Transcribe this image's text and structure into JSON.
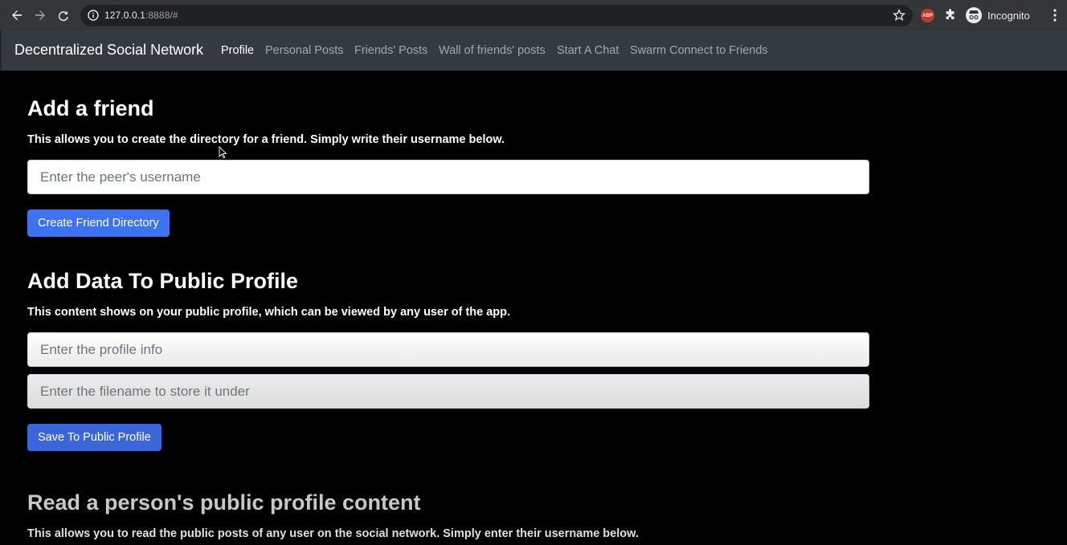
{
  "browser": {
    "url_host": "127.0.0.1",
    "url_rest": ":8888/#",
    "incognito_label": "Incognito",
    "abp_label": "ABP"
  },
  "navbar": {
    "brand": "Decentralized Social Network",
    "links": [
      {
        "label": "Profile",
        "active": true
      },
      {
        "label": "Personal Posts"
      },
      {
        "label": "Friends' Posts"
      },
      {
        "label": "Wall of friends' posts"
      },
      {
        "label": "Start A Chat"
      },
      {
        "label": "Swarm Connect to Friends"
      }
    ]
  },
  "add_friend": {
    "title": "Add a friend",
    "description": "This allows you to create the directory for a friend. Simply write their username below.",
    "input_placeholder": "Enter the peer's username",
    "button_label": "Create Friend Directory"
  },
  "public_profile": {
    "title": "Add Data To Public Profile",
    "description": "This content shows on your public profile, which can be viewed by any user of the app.",
    "info_placeholder": "Enter the profile info",
    "filename_placeholder": "Enter the filename to store it under",
    "button_label": "Save To Public Profile"
  },
  "read_profile": {
    "title": "Read a person's public profile content",
    "description": "This allows you to read the public posts of any user on the social network. Simply enter their username below."
  },
  "colors": {
    "primary": "#3d72f0",
    "navbar_bg": "#343a40",
    "page_bg": "#000000"
  }
}
